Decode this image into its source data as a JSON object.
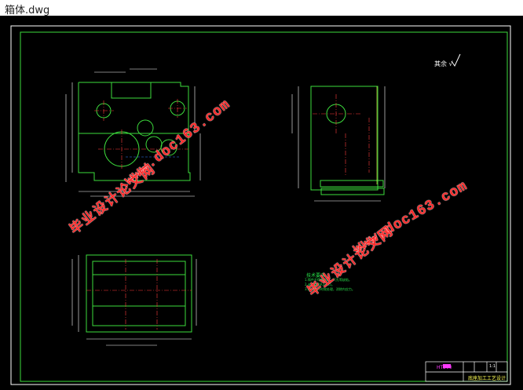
{
  "window": {
    "title": "箱体.dwg"
  },
  "watermarks": {
    "url": "www.doc163.com",
    "cn": "毕业设计论文网"
  },
  "drawing": {
    "roughness_mark": "其余 √",
    "tech_notes": [
      "技术要求",
      "1.铸件不得有砂眼、气孔等缺陷。",
      "2.未注圆角R3~R5。",
      "3.箱体进行时效处理，消除内应力。"
    ],
    "title_block": {
      "part_name": "底座加工工艺设计",
      "material": "HT200",
      "scale": "1:1"
    }
  },
  "colors": {
    "background": "#000000",
    "border": "#ffffff",
    "frame": "#3ddc3d",
    "dimension": "#ffffff",
    "center_line": "#ff3b3b",
    "hidden_line": "#2e7dff",
    "annotation": "#ffff55",
    "part_outline": "#3ddc3d"
  }
}
